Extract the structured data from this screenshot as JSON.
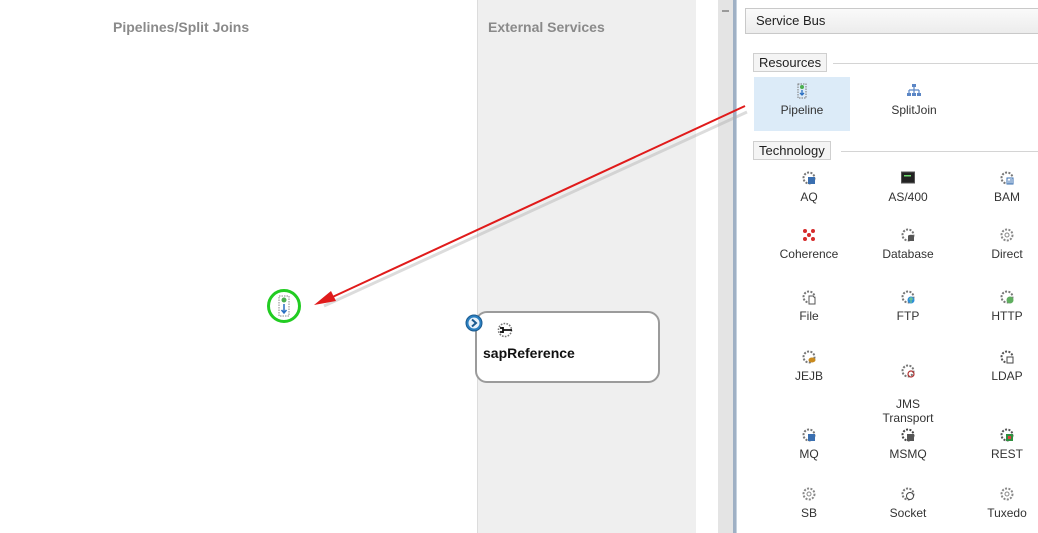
{
  "lanes": {
    "pipelines_title": "Pipelines/Split Joins",
    "external_title": "External Services"
  },
  "service": {
    "name": "sapReference"
  },
  "palette": {
    "header": "Service Bus",
    "sections": {
      "resources": "Resources",
      "technology": "Technology"
    },
    "resources": [
      "Pipeline",
      "SplitJoin"
    ],
    "technology": [
      [
        "AQ",
        "AS/400",
        "BAM"
      ],
      [
        "Coherence",
        "Database",
        "Direct"
      ],
      [
        "File",
        "FTP",
        "HTTP"
      ],
      [
        "JEJB",
        "JMS\nTransport",
        "LDAP"
      ],
      [
        "MQ",
        "MSMQ",
        "REST"
      ],
      [
        "SB",
        "Socket",
        "Tuxedo"
      ]
    ],
    "selected": "Pipeline"
  },
  "colors": {
    "arrow": "#e01b1b",
    "drop_ring": "#22cc22",
    "port": "#2a7fc0",
    "selection": "#dcebf8"
  }
}
